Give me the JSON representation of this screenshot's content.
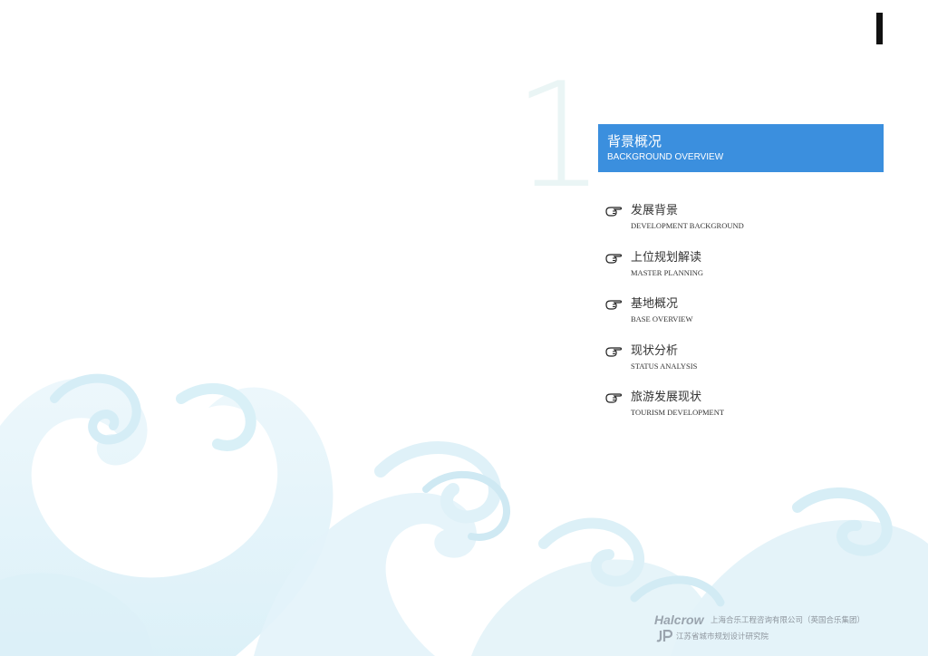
{
  "section": {
    "number": "1",
    "title_zh": "背景概况",
    "title_en": "BACKGROUND OVERVIEW"
  },
  "toc": {
    "items": [
      {
        "zh": "发展背景",
        "en": "DEVELOPMENT BACKGROUND"
      },
      {
        "zh": "上位规划解读",
        "en": "MASTER PLANNING"
      },
      {
        "zh": "基地概况",
        "en": "BASE OVERVIEW"
      },
      {
        "zh": "现状分析",
        "en": "STATUS ANALYSIS"
      },
      {
        "zh": "旅游发展现状",
        "en": "TOURISM DEVELOPMENT"
      }
    ],
    "icon": "pointing-hand-icon"
  },
  "footer": {
    "logo_text": "Halcrow",
    "company_1": "上海合乐工程咨询有限公司（英国合乐集团）",
    "logo_2": "JP",
    "company_2": "江苏省城市规划设计研究院"
  },
  "colors": {
    "accent": "#3b8fde",
    "wave_light": "#e9f6fa",
    "wave_mid": "#d4eef6",
    "text": "#333333"
  }
}
